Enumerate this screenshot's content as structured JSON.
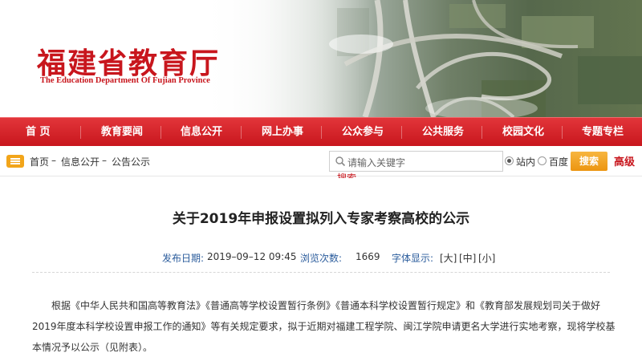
{
  "header": {
    "logo_cn": "福建省教育厅",
    "logo_en": "The Education Department Of Fujian Province"
  },
  "nav": {
    "items": [
      "首 页",
      "教育要闻",
      "信息公开",
      "网上办事",
      "公众参与",
      "公共服务",
      "校园文化",
      "专题专栏"
    ]
  },
  "breadcrumb": {
    "home": "首页",
    "sep1": "–",
    "level1": "信息公开",
    "sep2": "–",
    "level2": "公告公示"
  },
  "search": {
    "placeholder": "请输入关键字",
    "scope_site": "站内",
    "scope_baidu": "百度",
    "button": "搜索",
    "advanced": "高级",
    "partial_link": "搜索"
  },
  "article": {
    "title": "关于2019年申报设置拟列入专家考察高校的公示",
    "publish_label": "发布日期:",
    "publish_date": "2019–09–12 09:45",
    "views_label": "浏览次数:",
    "views": "1669",
    "font_label": "字体显示:",
    "font_large": "[大]",
    "font_medium": "[中]",
    "font_small": "[小]",
    "body": "根据《中华人民共和国高等教育法》《普通高等学校设置暂行条例》《普通本科学校设置暂行规定》和《教育部发展规划司关于做好2019年度本科学校设置申报工作的通知》等有关规定要求，拟于近期对福建工程学院、闽江学院申请更名大学进行实地考察，现将学校基本情况予以公示（见附表）。"
  },
  "colors": {
    "brand_red": "#c8161d",
    "nav_red": "#d9252b",
    "meta_blue": "#2b5c9c",
    "search_orange": "#f0a020"
  },
  "icons": [
    "list-icon",
    "search-icon"
  ]
}
